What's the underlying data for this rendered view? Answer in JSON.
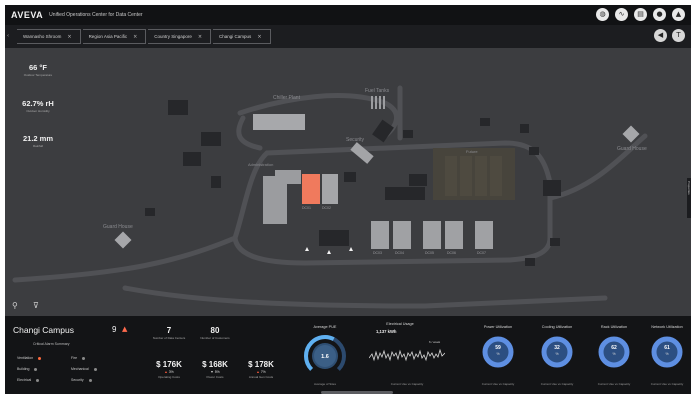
{
  "header": {
    "logo": "AVEVA",
    "title": "Unified Operations Center for Data Center",
    "icons": [
      "globe-icon",
      "chart-icon",
      "reports-icon",
      "user-icon",
      "lock-icon"
    ]
  },
  "breadcrumbs": [
    {
      "label": "Wannasho Shroom"
    },
    {
      "label": "Region Asia Pacific"
    },
    {
      "label": "Country Singapore"
    },
    {
      "label": "Changi Campus"
    }
  ],
  "breadcrumb_tools": [
    "back-icon",
    "info-icon"
  ],
  "weather": [
    {
      "value": "66 °F",
      "label": "Outdoor Temperature"
    },
    {
      "value": "62.7% rH",
      "label": "Outdoor Humidity"
    },
    {
      "value": "21.2 mm",
      "label": "Rainfall"
    }
  ],
  "map": {
    "labels": {
      "chiller_plant": "Chiller Plant",
      "fuel_tanks": "Fuel Tanks",
      "security": "Security",
      "guard_house_left": "Guard House",
      "guard_house_right": "Guard House",
      "admin": "Administration",
      "future": "Future"
    },
    "building_tags": [
      "DC01",
      "DC02",
      "DC03",
      "DC04",
      "DC05",
      "DC06",
      "DC07"
    ],
    "edge_label": "Properties"
  },
  "dashboard": {
    "campus": "Changi Campus",
    "alarm_count": "9",
    "critical_title": "Critical Alarm Summary",
    "alarms": [
      {
        "name": "Ventilation",
        "color": "#ff6a3d"
      },
      {
        "name": "Fire",
        "color": "#8a8a8a"
      },
      {
        "name": "Building",
        "color": "#8a8a8a"
      },
      {
        "name": "Mechanical",
        "color": "#8a8a8a"
      },
      {
        "name": "Electrical",
        "color": "#8a8a8a"
      },
      {
        "name": "Security",
        "color": "#8a8a8a"
      }
    ],
    "kpis": [
      {
        "value": "7",
        "label": "Number of Data Centers"
      },
      {
        "value": "80",
        "label": "Number of Customers"
      },
      {
        "value": "$ 176K",
        "label": "Operating Costs",
        "delta": "3%",
        "dir": "up"
      },
      {
        "value": "$ 168K",
        "label": "Power Costs",
        "delta": "5%",
        "dir": "down"
      },
      {
        "value": "$ 178K",
        "label": "Annual Gen Costs",
        "delta": "7%",
        "dir": "up"
      }
    ],
    "pue": {
      "title": "Average PUE",
      "value": "1.6",
      "foot": "Average of Sites",
      "fraction": 0.6
    },
    "electrical": {
      "title": "Electrical Usage",
      "value": "1,137 kWh",
      "foot": "Current Use vs Capacity",
      "tag": "6 / week"
    },
    "utilizations": [
      {
        "title": "Power Utilization",
        "value": "59",
        "unit": "%",
        "foot": "Current Use vs Capacity",
        "fraction": 0.59
      },
      {
        "title": "Cooling Utilization",
        "value": "32",
        "unit": "%",
        "foot": "Current Use vs Capacity",
        "fraction": 0.32
      },
      {
        "title": "Rack Utilization",
        "value": "62",
        "unit": "%",
        "foot": "Current Use vs Capacity",
        "fraction": 0.62
      },
      {
        "title": "Network Utilization",
        "value": "61",
        "unit": "%",
        "foot": "Current Use vs Capacity",
        "fraction": 0.61
      }
    ],
    "accent": "#5b8fe0",
    "alarm_color": "#ff6a4d"
  }
}
